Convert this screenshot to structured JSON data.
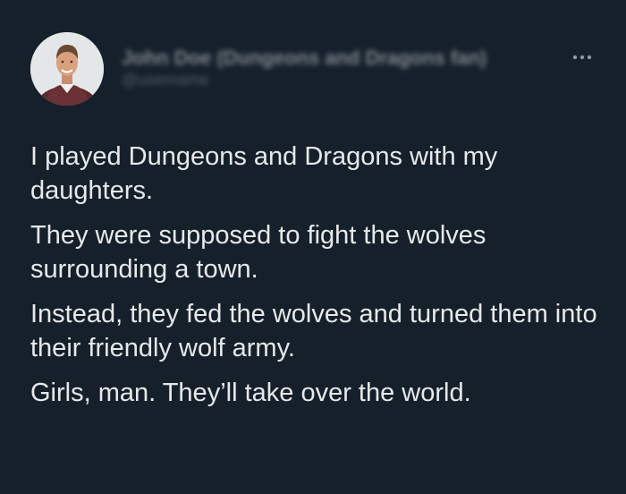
{
  "author": {
    "display_name": "John Doe (Dungeons and Dragons fan)",
    "handle": "@username"
  },
  "icons": {
    "more": "more-dots-icon",
    "avatar": "avatar-photo"
  },
  "tweet": {
    "paragraphs": [
      "I played Dungeons and Dragons with my daughters.",
      "They were supposed to fight the wolves surrounding a town.",
      "Instead, they fed the wolves and turned them into their friendly wolf army.",
      "Girls, man. They’ll take over the world."
    ]
  },
  "colors": {
    "background": "#15202b",
    "text": "#e7e9ea",
    "secondary": "#8b98a5"
  }
}
